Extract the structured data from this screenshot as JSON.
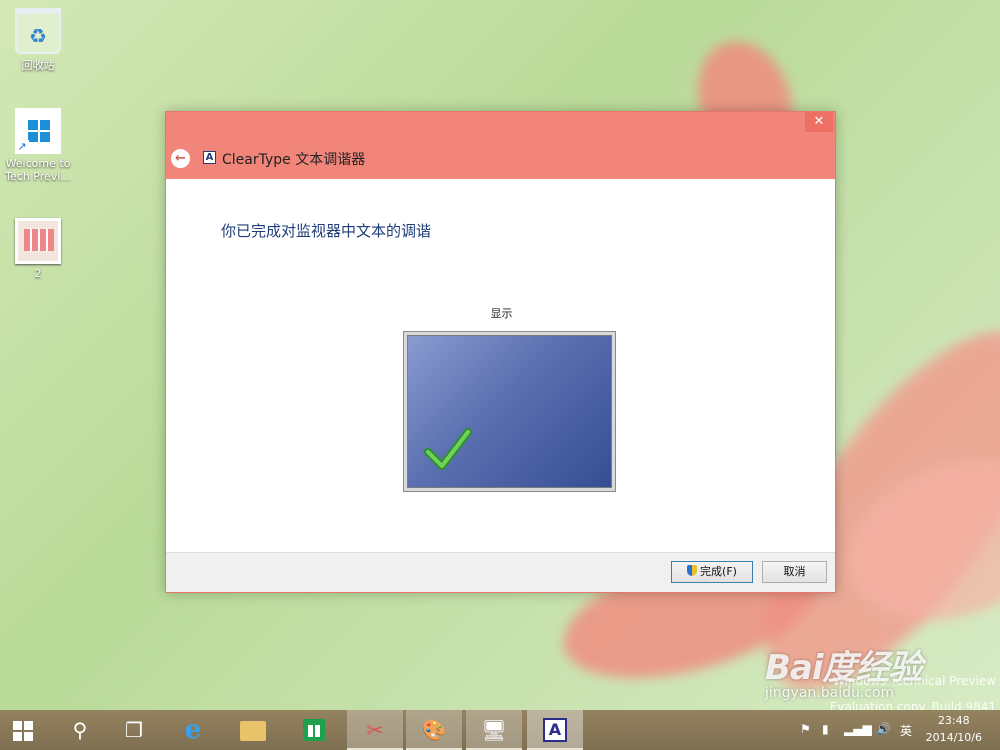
{
  "desktop": {
    "icons": [
      {
        "label": "回收站",
        "icon": "recycle-bin-icon"
      },
      {
        "label": "Welcome to Tech Previ...",
        "icon": "windows-logo-icon"
      },
      {
        "label": "2",
        "icon": "image-thumbnail-icon"
      }
    ],
    "build_text_top": "Windows Technical Preview",
    "build_text_bottom": "Evaluation copy. Build 9841"
  },
  "dialog": {
    "title": "ClearType 文本调谐器",
    "close_glyph": "✕",
    "back_glyph": "←",
    "app_icon_letter": "A",
    "heading": "你已完成对监视器中文本的调谐",
    "monitor_label": "显示",
    "buttons": {
      "finish": "完成(F)",
      "cancel": "取消"
    },
    "accent_color": "#f2857a"
  },
  "taskbar": {
    "items": [
      {
        "name": "start",
        "icon": "windows-start-icon"
      },
      {
        "name": "search",
        "icon": "search-icon",
        "glyph": "⚲"
      },
      {
        "name": "task-view",
        "icon": "task-view-icon",
        "glyph": "❐"
      },
      {
        "name": "internet-explorer",
        "icon": "ie-icon",
        "glyph": "e"
      },
      {
        "name": "file-explorer",
        "icon": "folder-icon"
      },
      {
        "name": "store",
        "icon": "store-icon"
      },
      {
        "name": "snipping-tool",
        "icon": "scissors-icon",
        "glyph": "✂"
      },
      {
        "name": "paint",
        "icon": "palette-icon",
        "glyph": "🎨"
      },
      {
        "name": "display",
        "icon": "monitor-icon",
        "glyph": "🖥"
      },
      {
        "name": "cleartype",
        "icon": "cleartype-icon",
        "glyph": "A"
      }
    ],
    "tray": {
      "ime": "英",
      "time": "23:48",
      "date": "2014/10/6"
    }
  },
  "watermark": {
    "main": "Bai度经验",
    "sub": "jingyan.baidu.com"
  }
}
